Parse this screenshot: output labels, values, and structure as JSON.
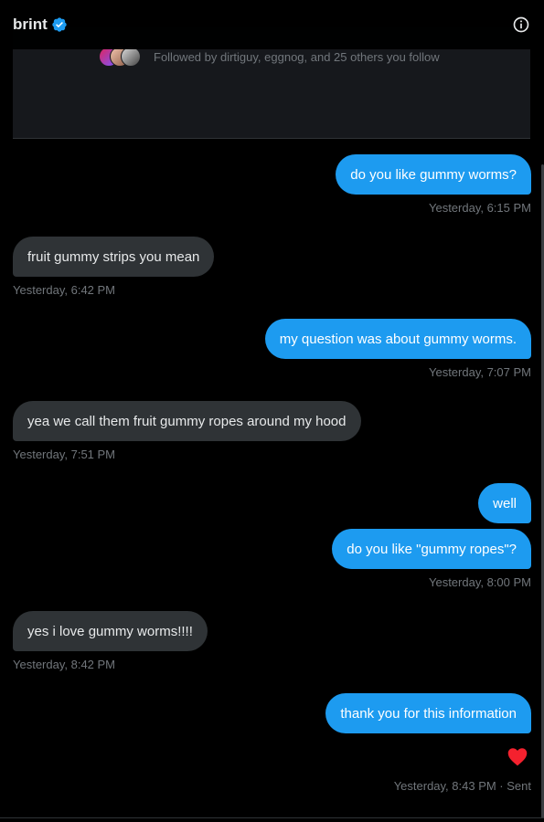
{
  "header": {
    "title": "brint",
    "verified_icon": "verified-badge-icon",
    "info_icon": "info-icon"
  },
  "profile": {
    "followed_by": "Followed by dirtiguy, eggnog, and 25 others you follow"
  },
  "colors": {
    "sent_bubble": "#1d9bf0",
    "received_bubble": "#2f3336",
    "timestamp": "#71767b",
    "heart": "#f91880"
  },
  "messages": [
    {
      "text": "do you like gummy worms?",
      "direction": "sent",
      "timestamp": "Yesterday, 6:15 PM"
    },
    {
      "text": "fruit gummy strips you mean",
      "direction": "received",
      "timestamp": "Yesterday, 6:42 PM"
    },
    {
      "text": "my question was about gummy worms.",
      "direction": "sent",
      "timestamp": "Yesterday, 7:07 PM"
    },
    {
      "text": "yea we call them fruit gummy ropes around my hood",
      "direction": "received",
      "timestamp": "Yesterday, 7:51 PM"
    },
    {
      "text": "well",
      "direction": "sent"
    },
    {
      "text": "do you like \"gummy ropes\"?",
      "direction": "sent",
      "timestamp": "Yesterday, 8:00 PM"
    },
    {
      "text": "yes i love gummy worms!!!!",
      "direction": "received",
      "timestamp": "Yesterday, 8:42 PM"
    },
    {
      "text": "thank you for this information",
      "direction": "sent",
      "reaction": "heart-icon",
      "timestamp": "Yesterday, 8:43 PM · Sent"
    }
  ]
}
